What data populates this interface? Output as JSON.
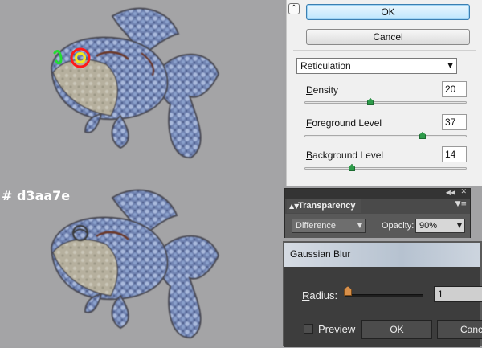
{
  "canvas": {
    "caption": "# d3aa7e",
    "fish_fill": "#7b8db8",
    "fish_belly": "#b8b3a2",
    "highlight_ring": "#ff1a1a",
    "highlight_dot": "#f4ea1a",
    "highlight_mark": "#22dd33"
  },
  "filter_gallery": {
    "collapse_icon": "chevron-up-icon",
    "ok_label": "OK",
    "cancel_label": "Cancel",
    "filter_name": "Reticulation",
    "params": [
      {
        "label": "Density",
        "access_key": "D",
        "rest": "ensity",
        "value": "20",
        "level": 0.4
      },
      {
        "label": "Foreground Level",
        "access_key": "F",
        "rest": "oreground Level",
        "value": "37",
        "level": 0.74
      },
      {
        "label": "Background Level",
        "access_key": "B",
        "rest": "ackground Level",
        "value": "14",
        "level": 0.28
      }
    ]
  },
  "transparency": {
    "tab_label": "Transparency",
    "blend_mode": "Difference",
    "opacity_label": "Opacity:",
    "opacity_value": "90%"
  },
  "gaussian_blur": {
    "title": "Gaussian Blur",
    "radius_label": "Radius:",
    "radius_access_key": "R",
    "radius_rest": "adius:",
    "radius_value": "1",
    "preview_label": "Preview",
    "preview_access_key": "P",
    "preview_rest": "review",
    "ok_label": "OK",
    "cancel_label": "Canc"
  }
}
